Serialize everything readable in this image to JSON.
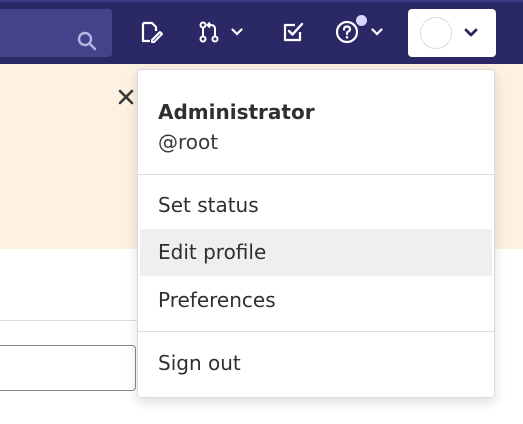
{
  "topbar": {
    "search": {
      "icon": "search-icon"
    },
    "nav_icons": [
      "issues-icon",
      "merge-request-icon",
      "todo-icon",
      "help-icon"
    ],
    "user_menu": {
      "avatar": "avatar"
    }
  },
  "banner": {
    "close_icon": "close-icon"
  },
  "dropdown": {
    "name": "Administrator",
    "username": "@root",
    "items": [
      {
        "label": "Set status",
        "active": false
      },
      {
        "label": "Edit profile",
        "active": true
      },
      {
        "label": "Preferences",
        "active": false
      }
    ],
    "sign_out": "Sign out"
  },
  "colors": {
    "topbar": "#2b2965",
    "banner": "#fdf1e1",
    "hover": "#efefef"
  }
}
